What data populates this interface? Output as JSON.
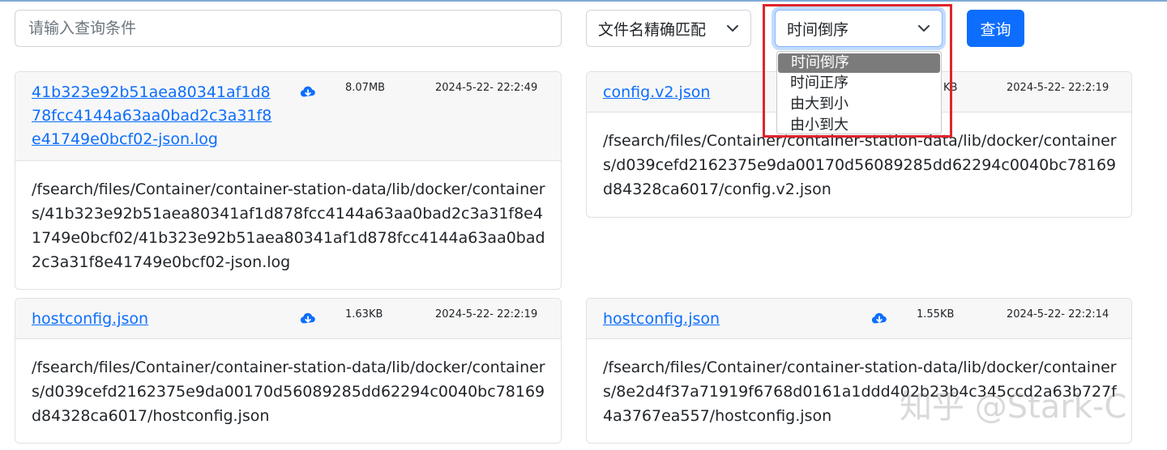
{
  "search": {
    "placeholder": "请输入查询条件",
    "value": ""
  },
  "match_select": {
    "selected": "文件名精确匹配"
  },
  "sort_select": {
    "selected": "时间倒序",
    "options": [
      "时间倒序",
      "时间正序",
      "由大到小",
      "由小到大"
    ]
  },
  "query_button": {
    "label": "查询"
  },
  "cards": [
    {
      "title": "41b323e92b51aea80341af1d878fcc4144a63aa0bad2c3a31f8e41749e0bcf02-json.log",
      "size": "8.07MB",
      "date": "2024-5-22- 22:2:49",
      "path": "/fsearch/files/Container/container-station-data/lib/docker/containers/41b323e92b51aea80341af1d878fcc4144a63aa0bad2c3a31f8e41749e0bcf02/41b323e92b51aea80341af1d878fcc4144a63aa0bad2c3a31f8e41749e0bcf02-json.log"
    },
    {
      "title": "config.v2.json",
      "size": "",
      "date": "2024-5-22- 22:2:19",
      "path": "/fsearch/files/Container/container-station-data/lib/docker/containers/d039cefd2162375e9da00170d56089285dd62294c0040bc78169d84328ca6017/config.v2.json"
    },
    {
      "title": "hostconfig.json",
      "size": "1.63KB",
      "date": "2024-5-22- 22:2:19",
      "path": "/fsearch/files/Container/container-station-data/lib/docker/containers/d039cefd2162375e9da00170d56089285dd62294c0040bc78169d84328ca6017/hostconfig.json"
    },
    {
      "title": "hostconfig.json",
      "size": "1.55KB",
      "date": "2024-5-22- 22:2:14",
      "path": "/fsearch/files/Container/container-station-data/lib/docker/containers/8e2d4f37a71919f6768d0161a1ddd402b23b4c345ccd2a63b727f4a3767ea557/hostconfig.json"
    }
  ],
  "watermark": "知乎 @Stark-C",
  "colors": {
    "primary": "#0d6efd",
    "highlight": "#e0242b",
    "selected_option": "#7b7b7b"
  }
}
